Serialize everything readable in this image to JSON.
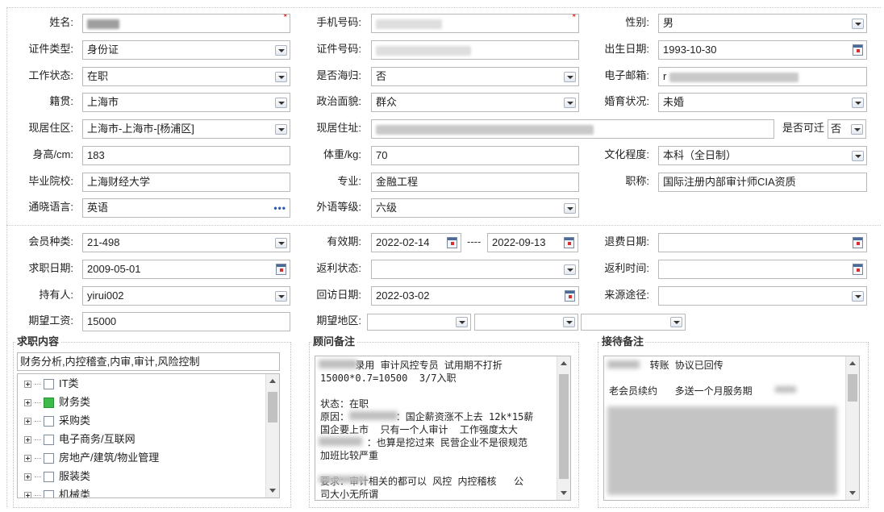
{
  "form": {
    "name_label": "姓名:",
    "mobile_label": "手机号码:",
    "gender_label": "性别:",
    "gender_value": "男",
    "id_type_label": "证件类型:",
    "id_type_value": "身份证",
    "id_number_label": "证件号码:",
    "birth_label": "出生日期:",
    "birth_value": "1993-10-30",
    "work_status_label": "工作状态:",
    "work_status_value": "在职",
    "returnee_label": "是否海归:",
    "returnee_value": "否",
    "email_label": "电子邮箱:",
    "email_prefix": "r",
    "native_label": "籍贯:",
    "native_value": "上海市",
    "political_label": "政治面貌:",
    "political_value": "群众",
    "marital_label": "婚育状况:",
    "marital_value": "未婚",
    "residence_label": "现居住区:",
    "residence_value": "上海市-上海市-[杨浦区]",
    "address_label": "现居住址:",
    "relocate_label": "是否可迁",
    "relocate_value": "否",
    "height_label": "身高/cm:",
    "height_value": "183",
    "weight_label": "体重/kg:",
    "weight_value": "70",
    "education_label": "文化程度:",
    "education_value": "本科（全日制）",
    "school_label": "毕业院校:",
    "school_value": "上海财经大学",
    "major_label": "专业:",
    "major_value": "金融工程",
    "title_label": "职称:",
    "title_value": "国际注册内部审计师CIA资质",
    "language_label": "通晓语言:",
    "language_value": "英语",
    "foreign_level_label": "外语等级:",
    "foreign_level_value": "六级"
  },
  "member": {
    "type_label": "会员种类:",
    "type_value": "21-498",
    "valid_label": "有效期:",
    "valid_from": "2022-02-14",
    "valid_sep": "----",
    "valid_to": "2022-09-13",
    "refund_date_label": "退费日期:",
    "job_date_label": "求职日期:",
    "job_date_value": "2009-05-01",
    "rebate_status_label": "返利状态:",
    "rebate_time_label": "返利时间:",
    "holder_label": "持有人:",
    "holder_value": "yirui002",
    "revisit_label": "回访日期:",
    "revisit_value": "2022-03-02",
    "source_label": "来源途径:",
    "salary_label": "期望工资:",
    "salary_value": "15000",
    "region_label": "期望地区:"
  },
  "job_content": {
    "title": "求职内容",
    "summary": "财务分析,内控稽查,内审,审计,风险控制",
    "tree": [
      {
        "label": "IT类",
        "checked": false
      },
      {
        "label": "财务类",
        "checked": true
      },
      {
        "label": "采购类",
        "checked": false
      },
      {
        "label": "电子商务/互联网",
        "checked": false
      },
      {
        "label": "房地产/建筑/物业管理",
        "checked": false
      },
      {
        "label": "服装类",
        "checked": false
      },
      {
        "label": "机械类",
        "checked": false
      }
    ]
  },
  "advisor_note": {
    "title": "顾问备注",
    "lines": [
      "      录用 审计风控专员 试用期不打折",
      "15000*0.7=10500  3/7入职",
      "",
      "状态：在职",
      "原因：        ：国企薪资涨不上去 12k*15薪",
      "国企要上市  只有一个人审计  工作强度太大",
      "        ：也算是挖过来 民营企业不是很规范",
      "加班比较严重",
      "",
      "要求：审计相关的都可以 风控 内控稽核   公",
      "司大小无所谓"
    ]
  },
  "reception_note": {
    "title": "接待备注",
    "lines": [
      "       转账 协议已回传",
      "",
      "老会员续约   多送一个月服务期"
    ]
  },
  "colors": {
    "required": "#d10000",
    "checked": "#3dbb4a",
    "border": "#b9b9b9"
  },
  "icons": [
    "dropdown-arrow-icon",
    "calendar-icon",
    "ellipsis-icon",
    "expand-plus-icon",
    "checkbox-icon",
    "scroll-arrow-icon"
  ]
}
